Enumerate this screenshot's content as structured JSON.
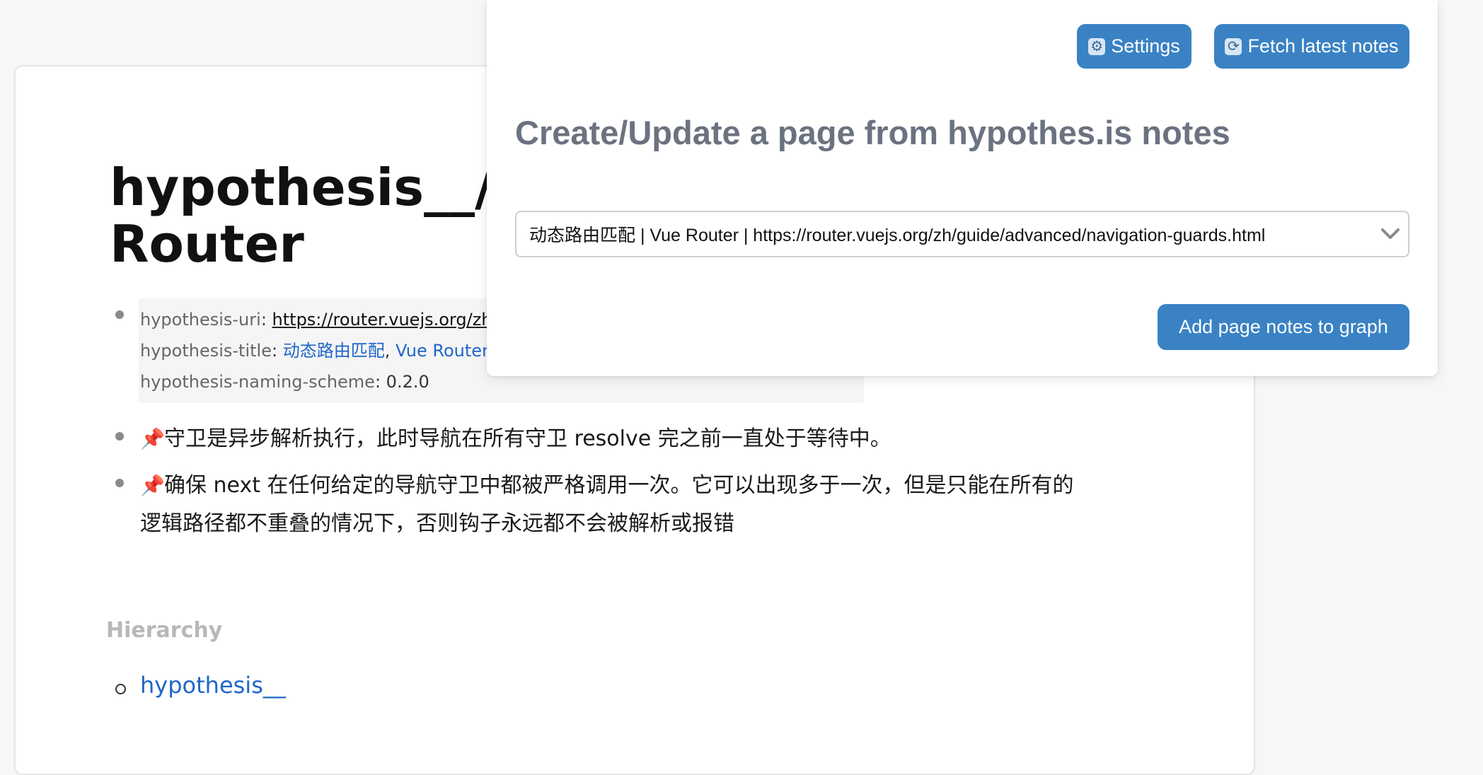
{
  "page": {
    "title": "hypothesis__/动\nRouter",
    "properties": {
      "uri_key": "hypothesis-uri",
      "uri_value": "https://router.vuejs.org/zh/",
      "title_key": "hypothesis-title",
      "title_value_1": "动态路由匹配",
      "title_sep": ",",
      "title_value_2": "Vue Router",
      "scheme_key": "hypothesis-naming-scheme",
      "scheme_value": "0.2.0"
    },
    "notes": [
      {
        "icon": "pin-icon",
        "text": "守卫是异步解析执行，此时导航在所有守卫 resolve 完之前一直处于等待中。"
      },
      {
        "icon": "pin-icon",
        "text_line1": "确保 next 在任何给定的导航守卫中都被严格调用一次。它可以出现多于一次，但是只能在所有的",
        "text_line2": "逻辑路径都不重叠的情况下，否则钩子永远都不会被解析或报错"
      }
    ],
    "hierarchy": {
      "label": "Hierarchy",
      "items": [
        "hypothesis__"
      ]
    }
  },
  "panel": {
    "settings_label": "Settings",
    "fetch_label": "Fetch latest notes",
    "title": "Create/Update a page from hypothes.is notes",
    "select_value": "动态路由匹配 | Vue Router | https://router.vuejs.org/zh/guide/advanced/navigation-guards.html",
    "add_button_label": "Add page notes to graph"
  },
  "colors": {
    "accent": "#3a82c4",
    "link": "#1f66c9",
    "panel_title": "#6b7280",
    "hierarchy_label": "#b8b8b8"
  }
}
